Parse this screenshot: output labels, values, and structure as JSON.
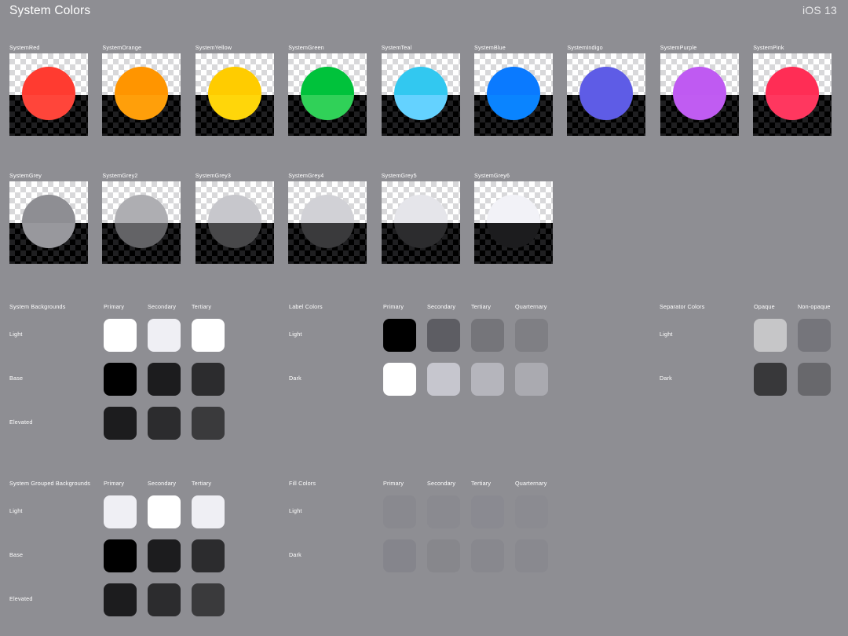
{
  "header": {
    "title": "System Colors",
    "os_version": "iOS 13"
  },
  "background_color": "#8E8E93",
  "system_colors": {
    "row1": [
      {
        "name": "SystemRed",
        "light": "#FF3B30",
        "dark": "#FF453A"
      },
      {
        "name": "SystemOrange",
        "light": "#FF9500",
        "dark": "#FF9F0A"
      },
      {
        "name": "SystemYellow",
        "light": "#FFCC00",
        "dark": "#FFD60A"
      },
      {
        "name": "SystemGreen",
        "light": "#00C23B",
        "dark": "#30D158"
      },
      {
        "name": "SystemTeal",
        "light": "#32C8F0",
        "dark": "#64D2FF"
      },
      {
        "name": "SystemBlue",
        "light": "#0A7AFF",
        "dark": "#0A84FF"
      },
      {
        "name": "SystemIndigo",
        "light": "#5E5CE6",
        "dark": "#5E5CE6"
      },
      {
        "name": "SystemPurple",
        "light": "#BF5AF2",
        "dark": "#C05CF2"
      },
      {
        "name": "SystemPink",
        "light": "#FF2D55",
        "dark": "#FF375F"
      }
    ],
    "row2": [
      {
        "name": "SystemGrey",
        "light": "#8E8E93",
        "dark": "#98989D"
      },
      {
        "name": "SystemGrey2",
        "light": "#AEAEB2",
        "dark": "#636366"
      },
      {
        "name": "SystemGrey3",
        "light": "#C7C7CC",
        "dark": "#48484A"
      },
      {
        "name": "SystemGrey4",
        "light": "#D1D1D6",
        "dark": "#3A3A3C"
      },
      {
        "name": "SystemGrey5",
        "light": "#E5E5EA",
        "dark": "#2C2C2E"
      },
      {
        "name": "SystemGrey6",
        "light": "#F2F2F7",
        "dark": "#1C1C1E"
      }
    ]
  },
  "system_backgrounds": {
    "title": "System Backgrounds",
    "columns": [
      "Primary",
      "Secondary",
      "Tertiary"
    ],
    "rows": [
      {
        "label": "Light",
        "values": [
          "#FFFFFF",
          "#EFEFF4",
          "#FFFFFF"
        ]
      },
      {
        "label": "Base",
        "values": [
          "#000000",
          "#1C1C1E",
          "#2C2C2E"
        ]
      },
      {
        "label": "Elevated",
        "values": [
          "#1C1C1E",
          "#2C2C2E",
          "#3A3A3C"
        ]
      }
    ]
  },
  "system_grouped_backgrounds": {
    "title": "System Grouped Backgrounds",
    "columns": [
      "Primary",
      "Secondary",
      "Tertiary"
    ],
    "rows": [
      {
        "label": "Light",
        "values": [
          "#EFEFF4",
          "#FFFFFF",
          "#EFEFF4"
        ]
      },
      {
        "label": "Base",
        "values": [
          "#000000",
          "#1C1C1E",
          "#2C2C2E"
        ]
      },
      {
        "label": "Elevated",
        "values": [
          "#1C1C1E",
          "#2C2C2E",
          "#3A3A3C"
        ]
      }
    ]
  },
  "label_colors": {
    "title": "Label Colors",
    "columns": [
      "Primary",
      "Secondary",
      "Tertiary",
      "Quarternary"
    ],
    "rows": [
      {
        "label": "Light",
        "values": [
          "rgba(0,0,0,1.00)",
          "rgba(60,60,67,0.60)",
          "rgba(60,60,67,0.30)",
          "rgba(60,60,67,0.18)"
        ]
      },
      {
        "label": "Dark",
        "values": [
          "rgba(255,255,255,1.00)",
          "rgba(235,235,245,0.60)",
          "rgba(235,235,245,0.42)",
          "rgba(235,235,245,0.30)"
        ]
      }
    ]
  },
  "fill_colors": {
    "title": "Fill Colors",
    "columns": [
      "Primary",
      "Secondary",
      "Tertiary",
      "Quarternary"
    ],
    "rows": [
      {
        "label": "Light",
        "values": [
          "rgba(120,120,128,0.20)",
          "rgba(120,120,128,0.16)",
          "rgba(118,118,128,0.12)",
          "rgba(116,116,128,0.08)"
        ]
      },
      {
        "label": "Dark",
        "values": [
          "rgba(120,120,128,0.36)",
          "rgba(120,120,128,0.32)",
          "rgba(118,118,128,0.24)",
          "rgba(116,116,128,0.18)"
        ]
      }
    ]
  },
  "separator_colors": {
    "title": "Separator Colors",
    "columns": [
      "Opaque",
      "Non-opaque"
    ],
    "rows": [
      {
        "label": "Light",
        "values": [
          "#C6C6C8",
          "rgba(60,60,67,0.29)"
        ]
      },
      {
        "label": "Dark",
        "values": [
          "#38383A",
          "rgba(84,84,88,0.65)"
        ]
      }
    ]
  }
}
